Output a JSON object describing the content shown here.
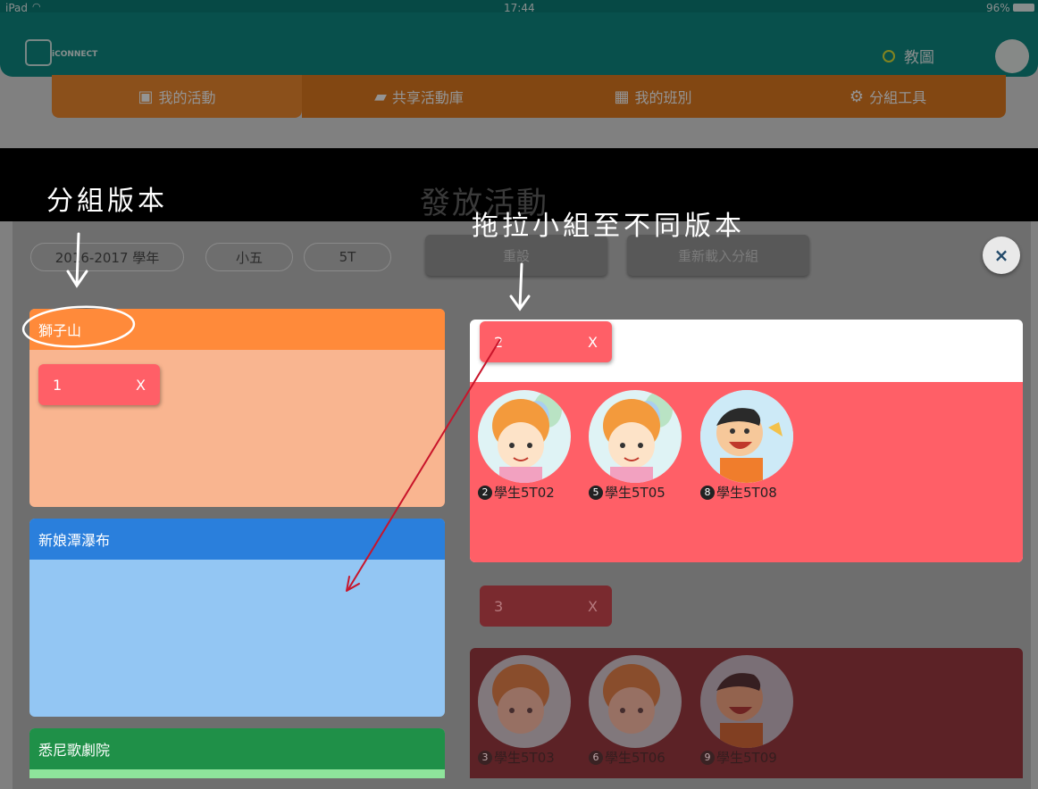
{
  "status": {
    "device": "iPad",
    "time": "17:44",
    "battery": "96%"
  },
  "app": {
    "logo_text": "iCONNECT",
    "user_name": "教圖"
  },
  "nav": {
    "tabs": [
      "我的活動",
      "共享活動庫",
      "我的班別",
      "分組工具"
    ]
  },
  "modal": {
    "title": "發放活動",
    "filters": {
      "year": "2016-2017 學年",
      "grade": "小五",
      "class": "5T"
    },
    "buttons": {
      "reset": "重設",
      "reload": "重新載入分組",
      "close": "×"
    }
  },
  "versions": [
    {
      "name": "獅子山",
      "color": "#ff8a3a",
      "body_color": "#f9b590",
      "chips": [
        {
          "label": "1",
          "remove": "X"
        }
      ]
    },
    {
      "name": "新娘潭瀑布",
      "color": "#2a7fdc",
      "body_color": "#93c6f3",
      "chips": []
    },
    {
      "name": "悉尼歌劇院",
      "color": "#1f9048",
      "body_color": "#8ee49b",
      "chips": []
    }
  ],
  "groups": [
    {
      "label": "2",
      "remove": "X",
      "students": [
        {
          "num": "2",
          "name": "學生5T02",
          "avatar": "girl-avatar"
        },
        {
          "num": "5",
          "name": "學生5T05",
          "avatar": "girl-avatar"
        },
        {
          "num": "8",
          "name": "學生5T08",
          "avatar": "boy-avatar"
        }
      ]
    },
    {
      "label": "3",
      "remove": "X",
      "students": [
        {
          "num": "3",
          "name": "學生5T03",
          "avatar": "girl-avatar"
        },
        {
          "num": "6",
          "name": "學生5T06",
          "avatar": "girl-avatar"
        },
        {
          "num": "9",
          "name": "學生5T09",
          "avatar": "boy-avatar"
        }
      ]
    }
  ],
  "annotations": {
    "left_note": "分組版本",
    "right_note": "拖拉小組至不同版本"
  },
  "colors": {
    "group_red": "#ff5f67",
    "chip_red": "#ff5f67",
    "teal": "#0f8a83",
    "orange_tab": "#f08a2f"
  }
}
